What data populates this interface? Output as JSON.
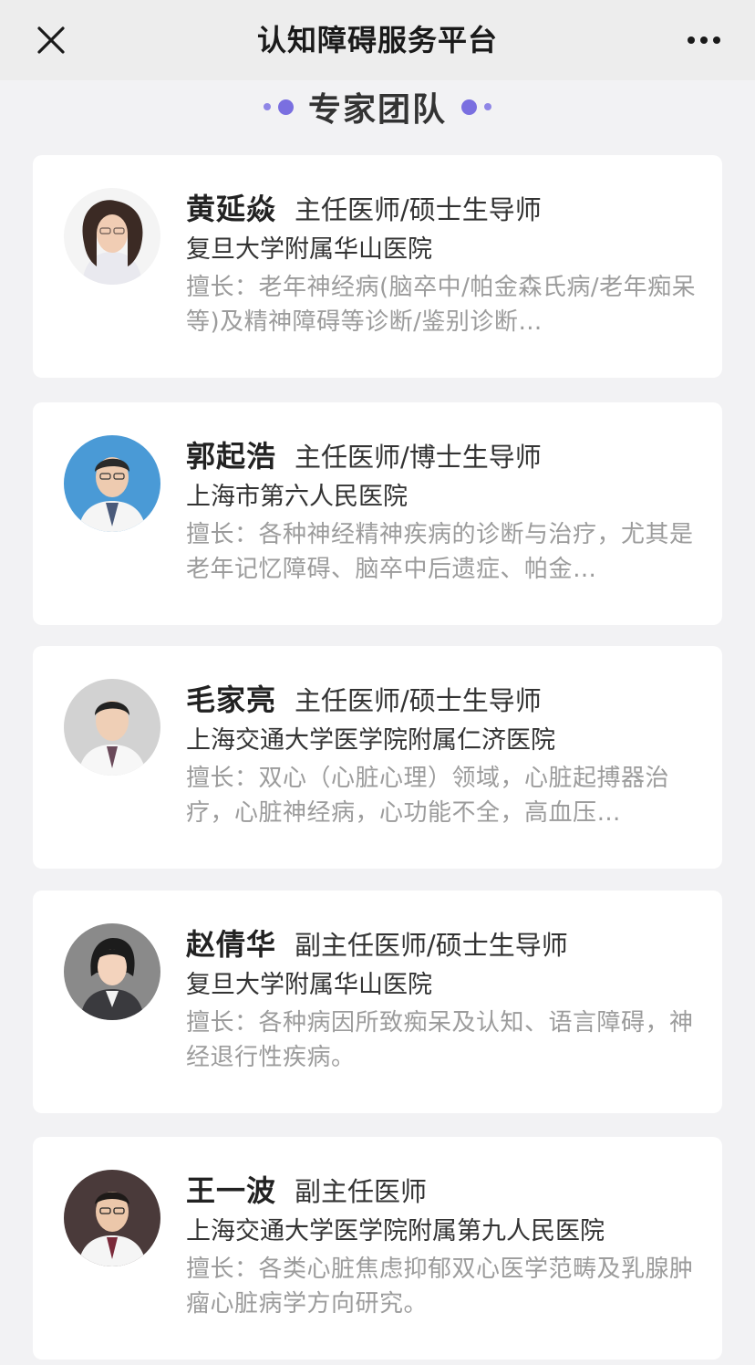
{
  "header": {
    "title": "认知障碍服务平台"
  },
  "section": {
    "title": "专家团队"
  },
  "colors": {
    "accent": "#7a6fe0",
    "card_bg": "#ffffff",
    "page_bg": "#f2f2f4",
    "header_bg": "#ededed"
  },
  "experts": [
    {
      "name": "黄延焱",
      "title": "主任医师/硕士生导师",
      "hospital": "复旦大学附属华山医院",
      "specialty": "擅长：老年神经病(脑卒中/帕金森氏病/老年痴呆等)及精神障碍等诊断/鉴别诊断…"
    },
    {
      "name": "郭起浩",
      "title": "主任医师/博士生导师",
      "hospital": "上海市第六人民医院",
      "specialty": "擅长：各种神经精神疾病的诊断与治疗，尤其是老年记忆障碍、脑卒中后遗症、帕金…"
    },
    {
      "name": "毛家亮",
      "title": "主任医师/硕士生导师",
      "hospital": "上海交通大学医学院附属仁济医院",
      "specialty": "擅长：双心（心脏心理）领域，心脏起搏器治疗，心脏神经病，心功能不全，高血压…"
    },
    {
      "name": "赵倩华",
      "title": "副主任医师/硕士生导师",
      "hospital": "复旦大学附属华山医院",
      "specialty": "擅长：各种病因所致痴呆及认知、语言障碍，神经退行性疾病。"
    },
    {
      "name": "王一波",
      "title": "副主任医师",
      "hospital": "上海交通大学医学院附属第九人民医院",
      "specialty": "擅长：各类心脏焦虑抑郁双心医学范畴及乳腺肿瘤心脏病学方向研究。"
    }
  ]
}
